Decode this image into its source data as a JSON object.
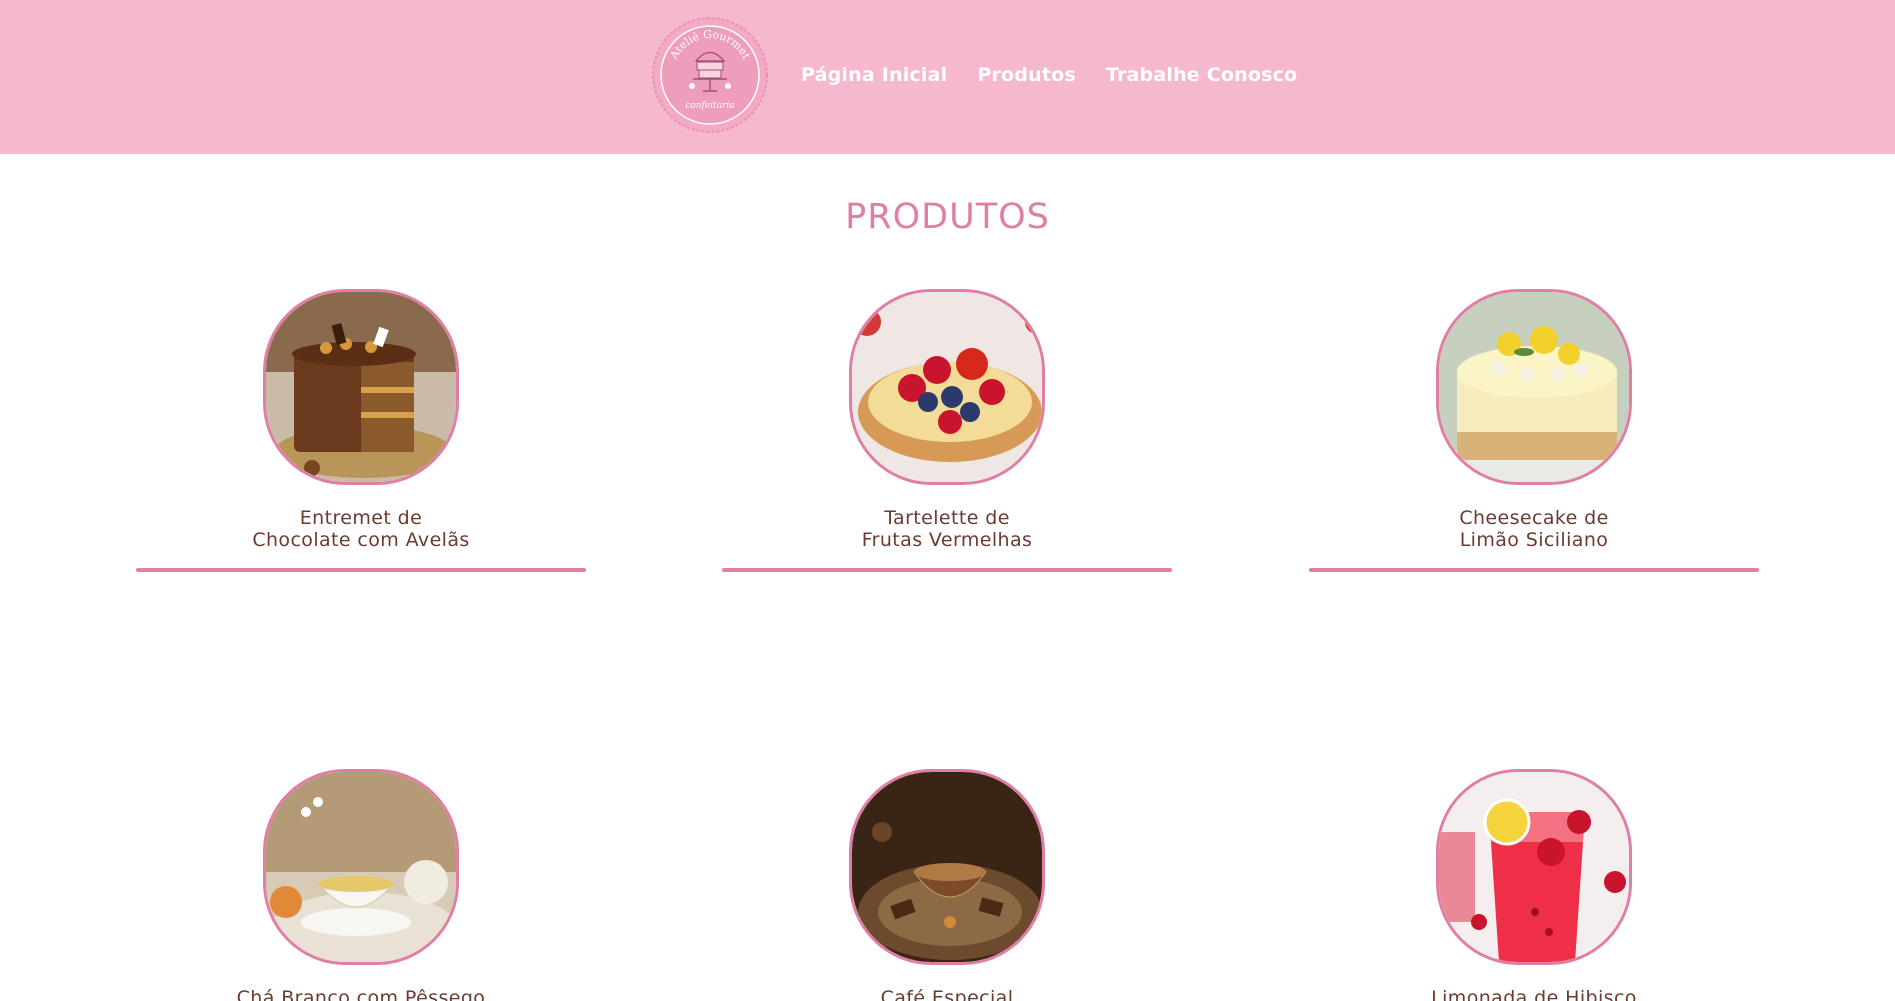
{
  "header": {
    "logo_text": "Ateliê Gourmet",
    "logo_subtext": "confeitaria",
    "nav": [
      {
        "label": "Página Inicial"
      },
      {
        "label": "Produtos"
      },
      {
        "label": "Trabalhe Conosco"
      }
    ],
    "colors": {
      "background": "#f5b8cf",
      "nav_text": "#ffffff"
    }
  },
  "main": {
    "title": "PRODUTOS",
    "accent_color": "#e07ea6",
    "text_color": "#6b3b2e",
    "products": [
      {
        "name_line1": "Entremet de",
        "name_line2": "Chocolate com Avelãs",
        "image": "chocolate-cake-image"
      },
      {
        "name_line1": "Tartelette de",
        "name_line2": "Frutas Vermelhas",
        "image": "berry-tart-image"
      },
      {
        "name_line1": "Cheesecake de",
        "name_line2": "Limão Siciliano",
        "image": "lemon-cheesecake-image"
      },
      {
        "name_line1": "Chá Branco com Pêssego",
        "name_line2": "",
        "image": "white-tea-image"
      },
      {
        "name_line1": "Café Especial",
        "name_line2": "",
        "image": "coffee-image"
      },
      {
        "name_line1": "Limonada de Hibisco",
        "name_line2": "",
        "image": "hibiscus-lemonade-image"
      }
    ]
  }
}
